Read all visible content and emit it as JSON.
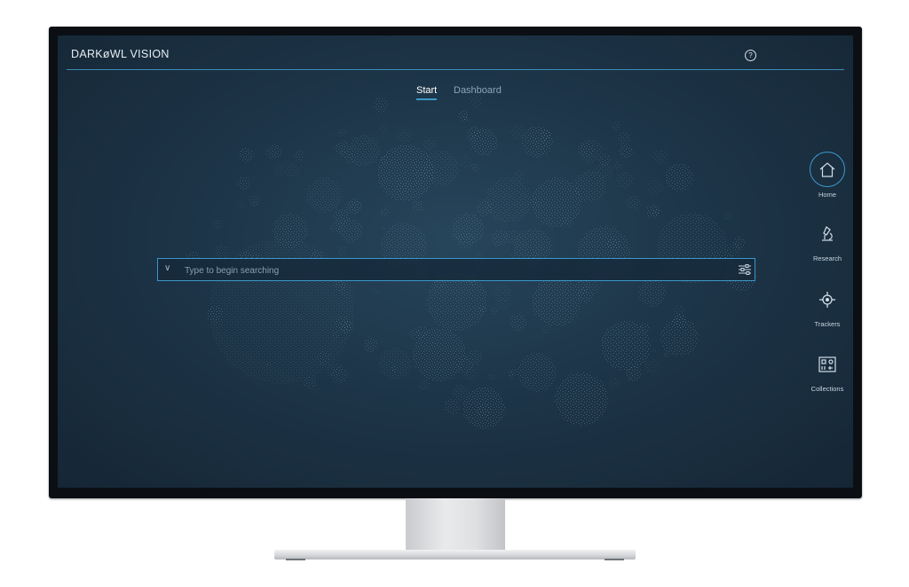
{
  "app": {
    "logo_text": "DARKøWL VISION"
  },
  "header": {
    "help_icon": "help-circle-icon",
    "help_glyph": "?"
  },
  "tabs": [
    {
      "label": "Start",
      "active": true
    },
    {
      "label": "Dashboard",
      "active": false
    }
  ],
  "search": {
    "placeholder": "Type to begin searching",
    "value": "",
    "dropdown_icon": "chevron-down-icon",
    "filter_icon": "sliders-icon",
    "chevron_glyph": "∨"
  },
  "nav": [
    {
      "label": "Home",
      "icon": "home-icon",
      "active": true
    },
    {
      "label": "Research",
      "icon": "microscope-icon",
      "active": false
    },
    {
      "label": "Trackers",
      "icon": "crosshair-icon",
      "active": false
    },
    {
      "label": "Collections",
      "icon": "collections-icon",
      "active": false
    }
  ],
  "colors": {
    "accent": "#3d98c6",
    "background": "#1d3548",
    "text": "#e8eef3"
  }
}
